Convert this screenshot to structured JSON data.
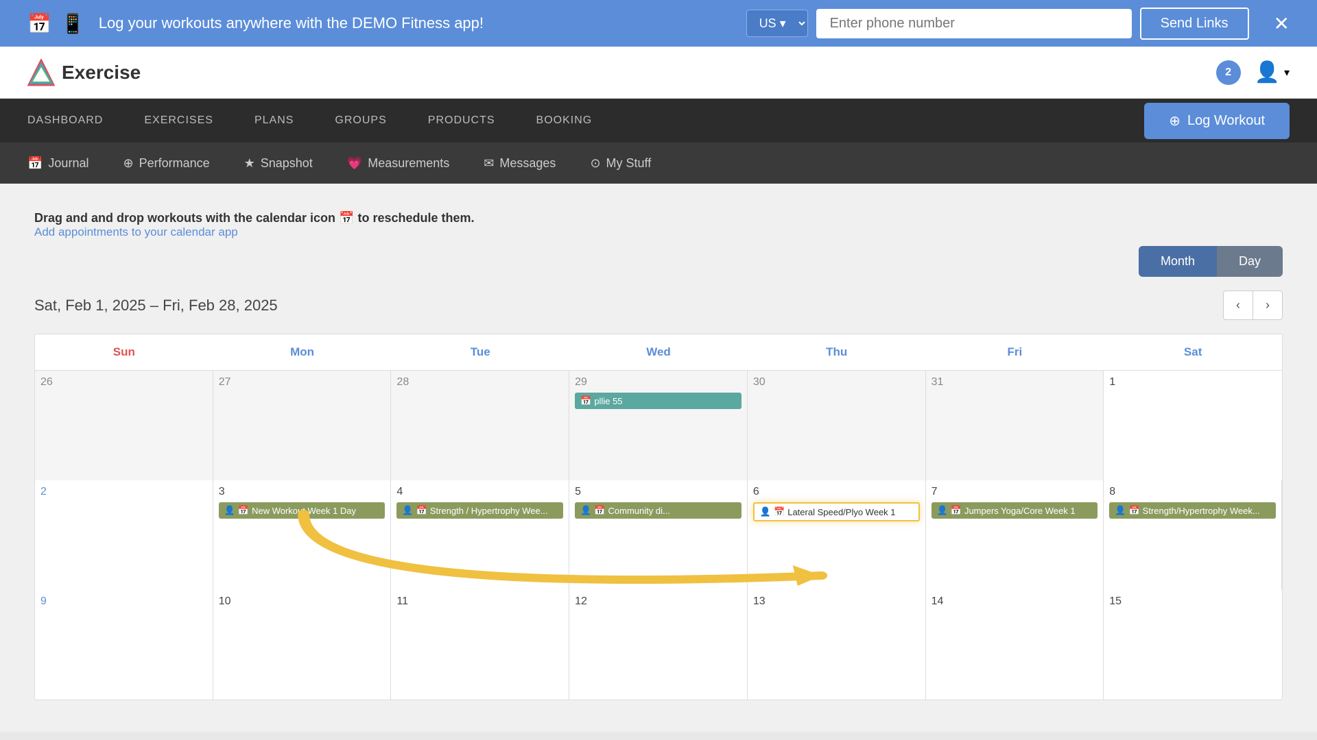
{
  "banner": {
    "icon1": "📅",
    "icon2": "📱",
    "text": "Log your workouts anywhere with the DEMO Fitness app!",
    "country": "US",
    "phone_placeholder": "Enter phone number",
    "send_links": "Send Links",
    "close": "✕"
  },
  "header": {
    "logo_text": "Exercise",
    "notification_count": "2",
    "chevron": "▾"
  },
  "main_nav": {
    "items": [
      {
        "label": "DASHBOARD",
        "id": "dashboard"
      },
      {
        "label": "EXERCISES",
        "id": "exercises"
      },
      {
        "label": "PLANS",
        "id": "plans"
      },
      {
        "label": "GROUPS",
        "id": "groups"
      },
      {
        "label": "PRODUCTS",
        "id": "products"
      },
      {
        "label": "BOOKING",
        "id": "booking"
      }
    ],
    "log_workout": "Log Workout"
  },
  "sub_nav": {
    "items": [
      {
        "label": "Journal",
        "icon": "📅",
        "id": "journal"
      },
      {
        "label": "Performance",
        "icon": "⊕",
        "id": "performance"
      },
      {
        "label": "Snapshot",
        "icon": "★",
        "id": "snapshot"
      },
      {
        "label": "Measurements",
        "icon": "💗",
        "id": "measurements"
      },
      {
        "label": "Messages",
        "icon": "✉",
        "id": "messages"
      },
      {
        "label": "My Stuff",
        "icon": "⊙",
        "id": "my-stuff"
      }
    ]
  },
  "content": {
    "drag_info": "Drag and and drop workouts with the calendar icon 📅 to reschedule them.",
    "add_appointments": "Add appointments to your calendar app",
    "view_month": "Month",
    "view_day": "Day",
    "date_range": "Sat, Feb 1, 2025 – Fri, Feb 28, 2025",
    "prev": "‹",
    "next": "›"
  },
  "calendar": {
    "headers": [
      {
        "label": "Sun",
        "type": "sun"
      },
      {
        "label": "Mon",
        "type": "weekday"
      },
      {
        "label": "Tue",
        "type": "weekday"
      },
      {
        "label": "Wed",
        "type": "weekday"
      },
      {
        "label": "Thu",
        "type": "weekday"
      },
      {
        "label": "Fri",
        "type": "weekday"
      },
      {
        "label": "Sat",
        "type": "sat"
      }
    ],
    "rows": [
      {
        "cells": [
          {
            "date": "26",
            "month": "other",
            "workouts": []
          },
          {
            "date": "27",
            "month": "other",
            "workouts": []
          },
          {
            "date": "28",
            "month": "other",
            "workouts": []
          },
          {
            "date": "29",
            "month": "other",
            "workouts": [
              {
                "label": "pllie 55",
                "type": "teal"
              }
            ]
          },
          {
            "date": "30",
            "month": "other",
            "workouts": []
          },
          {
            "date": "31",
            "month": "other",
            "workouts": []
          },
          {
            "date": "1",
            "month": "current",
            "workouts": []
          }
        ]
      },
      {
        "cells": [
          {
            "date": "2",
            "month": "current",
            "workouts": []
          },
          {
            "date": "3",
            "month": "current",
            "workouts": [
              {
                "label": "New Workout Week 1 Day",
                "type": "olive"
              }
            ]
          },
          {
            "date": "4",
            "month": "current",
            "workouts": [
              {
                "label": "Strength / Hypertrophy Wee",
                "type": "olive"
              }
            ]
          },
          {
            "date": "5",
            "month": "current",
            "workouts": [
              {
                "label": "Community di",
                "type": "olive"
              }
            ]
          },
          {
            "date": "6",
            "month": "current",
            "workouts": [
              {
                "label": "Lateral Speed/Plyo Week 1",
                "type": "highlighted"
              }
            ]
          },
          {
            "date": "7",
            "month": "current",
            "workouts": [
              {
                "label": "Jumpers Yoga/Core Week 1",
                "type": "olive"
              }
            ]
          },
          {
            "date": "8",
            "month": "current",
            "workouts": [
              {
                "label": "Strength/Hypertrophy Week",
                "type": "olive"
              }
            ]
          }
        ]
      },
      {
        "cells": [
          {
            "date": "9",
            "month": "current",
            "workouts": []
          },
          {
            "date": "10",
            "month": "current",
            "workouts": []
          },
          {
            "date": "11",
            "month": "current",
            "workouts": []
          },
          {
            "date": "12",
            "month": "current",
            "workouts": []
          },
          {
            "date": "13",
            "month": "current",
            "workouts": []
          },
          {
            "date": "14",
            "month": "current",
            "workouts": []
          },
          {
            "date": "15",
            "month": "current",
            "workouts": []
          }
        ]
      }
    ]
  },
  "annotation": {
    "arrow_source_col": 1,
    "arrow_target_col": 3,
    "source_label": "New Workout Week Day"
  }
}
